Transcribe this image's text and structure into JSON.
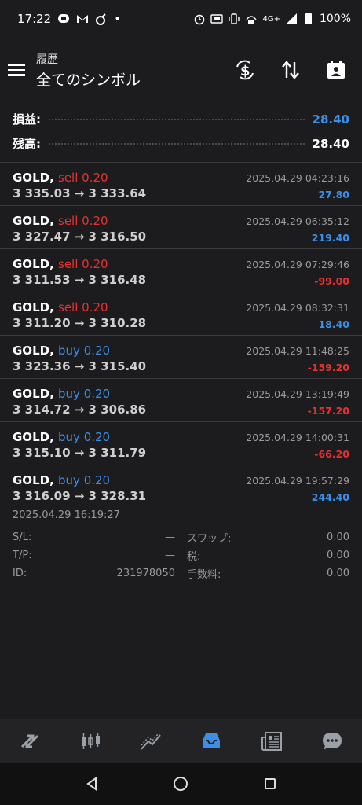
{
  "status_bar": {
    "time": "17:22",
    "battery": "100%",
    "signal": "4G+"
  },
  "header": {
    "subtitle": "履歴",
    "title": "全てのシンボル"
  },
  "summary": {
    "profit_label": "損益:",
    "profit_value": "28.40",
    "balance_label": "残高:",
    "balance_value": "28.40"
  },
  "trades": [
    {
      "symbol": "GOLD,",
      "side": "sell 0.20",
      "side_type": "sell",
      "prices": "3 335.03 → 3 333.64",
      "datetime": "2025.04.29 04:23:16",
      "profit": "27.80",
      "profit_type": "pos"
    },
    {
      "symbol": "GOLD,",
      "side": "sell 0.20",
      "side_type": "sell",
      "prices": "3 327.47 → 3 316.50",
      "datetime": "2025.04.29 06:35:12",
      "profit": "219.40",
      "profit_type": "pos"
    },
    {
      "symbol": "GOLD,",
      "side": "sell 0.20",
      "side_type": "sell",
      "prices": "3 311.53 → 3 316.48",
      "datetime": "2025.04.29 07:29:46",
      "profit": "-99.00",
      "profit_type": "neg"
    },
    {
      "symbol": "GOLD,",
      "side": "sell 0.20",
      "side_type": "sell",
      "prices": "3 311.20 → 3 310.28",
      "datetime": "2025.04.29 08:32:31",
      "profit": "18.40",
      "profit_type": "pos"
    },
    {
      "symbol": "GOLD,",
      "side": "buy 0.20",
      "side_type": "buy",
      "prices": "3 323.36 → 3 315.40",
      "datetime": "2025.04.29 11:48:25",
      "profit": "-159.20",
      "profit_type": "neg"
    },
    {
      "symbol": "GOLD,",
      "side": "buy 0.20",
      "side_type": "buy",
      "prices": "3 314.72 → 3 306.86",
      "datetime": "2025.04.29 13:19:49",
      "profit": "-157.20",
      "profit_type": "neg"
    },
    {
      "symbol": "GOLD,",
      "side": "buy 0.20",
      "side_type": "buy",
      "prices": "3 315.10 → 3 311.79",
      "datetime": "2025.04.29 14:00:31",
      "profit": "-66.20",
      "profit_type": "neg"
    }
  ],
  "expanded_trade": {
    "symbol": "GOLD,",
    "side": "buy 0.20",
    "prices": "3 316.09 → 3 328.31",
    "datetime": "2025.04.29 19:57:29",
    "profit": "244.40",
    "open_time": "2025.04.29 16:19:27",
    "sl_label": "S/L:",
    "sl_value": "—",
    "swap_label": "スワップ:",
    "swap_value": "0.00",
    "tp_label": "T/P:",
    "tp_value": "—",
    "tax_label": "税:",
    "tax_value": "0.00",
    "id_label": "ID:",
    "id_value": "231978050",
    "fee_label": "手数料:",
    "fee_value": "0.00"
  },
  "bottom_nav": [
    "quotes-icon",
    "chart-icon",
    "trade-icon",
    "history-icon",
    "news-icon",
    "chat-icon"
  ],
  "colors": {
    "accent": "#3b8fe8",
    "loss": "#e5312f",
    "background": "#1c1c1e"
  }
}
